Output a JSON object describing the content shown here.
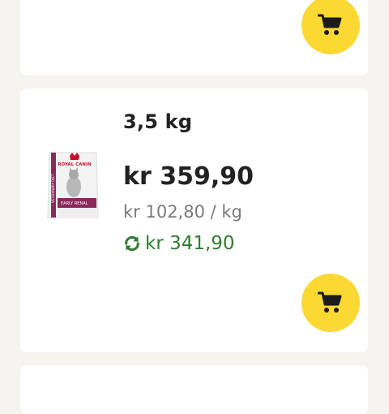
{
  "product": {
    "weight": "3,5 kg",
    "price": "kr 359,90",
    "unit_price": "kr 102,80 / kg",
    "subscription_price": "kr 341,90",
    "image_brand": "ROYAL CANIN",
    "image_label": "EARLY RENAL",
    "image_side_text": "VETERINARY DIET"
  },
  "icons": {
    "cart": "cart-icon",
    "subscription": "refresh-icon"
  },
  "colors": {
    "cart_button": "#fcd832",
    "subscription_green": "#2f7d32",
    "brand_red": "#c8102e",
    "pack_purple": "#8a2a5c"
  }
}
